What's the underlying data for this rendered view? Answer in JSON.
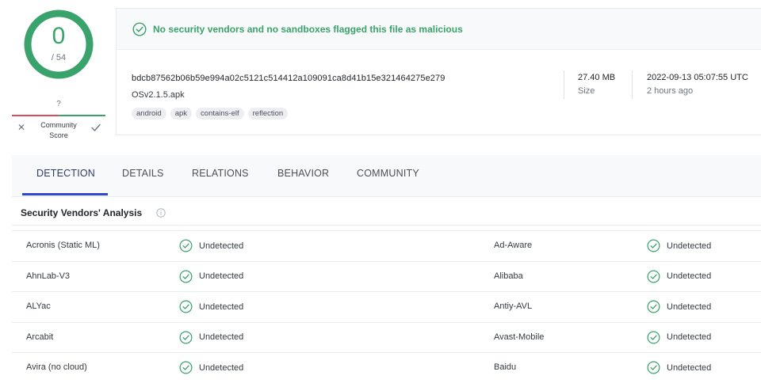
{
  "score": {
    "detections": "0",
    "total": "/ 54",
    "accent_color": "#3aa26b"
  },
  "community": {
    "value": "?",
    "label_line1": "Community",
    "label_line2": "Score",
    "negative_color": "#d84c5c",
    "positive_color": "#3aa26b"
  },
  "summary": {
    "banner": "No security vendors and no sandboxes flagged this file as malicious",
    "hash": "bdcb87562b06b59e994a02c5121c514412a109091ca8d41b15e321464275e279",
    "filename": "OSv2.1.5.apk",
    "tags": [
      "android",
      "apk",
      "contains-elf",
      "reflection"
    ],
    "size_value": "27.40 MB",
    "size_label": "Size",
    "date_value": "2022-09-13 05:07:55 UTC",
    "date_label": "2 hours ago"
  },
  "tabs": [
    {
      "label": "DETECTION",
      "active": true
    },
    {
      "label": "DETAILS",
      "active": false
    },
    {
      "label": "RELATIONS",
      "active": false
    },
    {
      "label": "BEHAVIOR",
      "active": false
    },
    {
      "label": "COMMUNITY",
      "active": false
    }
  ],
  "section": {
    "title": "Security Vendors' Analysis"
  },
  "vendors": [
    {
      "left": {
        "name": "Acronis (Static ML)",
        "result": "Undetected"
      },
      "right": {
        "name": "Ad-Aware",
        "result": "Undetected"
      }
    },
    {
      "left": {
        "name": "AhnLab-V3",
        "result": "Undetected"
      },
      "right": {
        "name": "Alibaba",
        "result": "Undetected"
      }
    },
    {
      "left": {
        "name": "ALYac",
        "result": "Undetected"
      },
      "right": {
        "name": "Antiy-AVL",
        "result": "Undetected"
      }
    },
    {
      "left": {
        "name": "Arcabit",
        "result": "Undetected"
      },
      "right": {
        "name": "Avast-Mobile",
        "result": "Undetected"
      }
    },
    {
      "left": {
        "name": "Avira (no cloud)",
        "result": "Undetected"
      },
      "right": {
        "name": "Baidu",
        "result": "Undetected"
      }
    }
  ],
  "icons": {
    "check": "check-circle-icon",
    "info": "info-icon",
    "close": "close-icon"
  }
}
